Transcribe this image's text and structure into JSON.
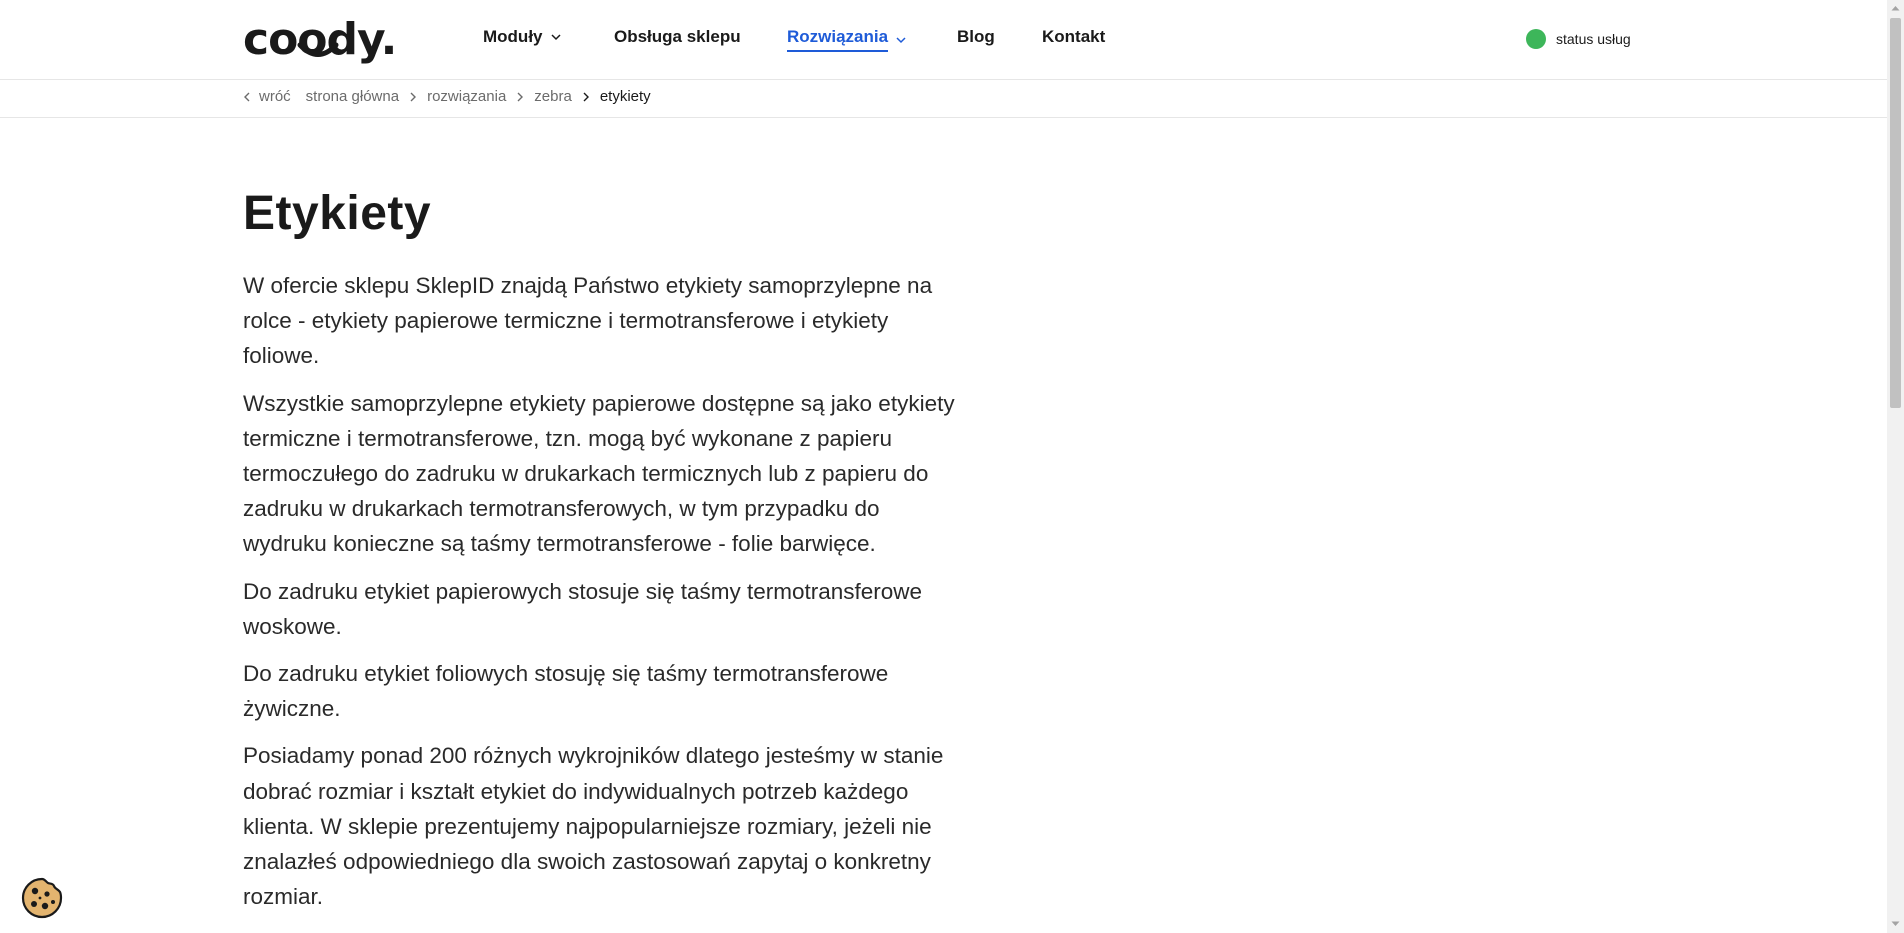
{
  "header": {
    "logo": "coody.",
    "nav": [
      {
        "label": "Moduły",
        "has_dropdown": true,
        "active": false
      },
      {
        "label": "Obsługa sklepu",
        "has_dropdown": false,
        "active": false
      },
      {
        "label": "Rozwiązania",
        "has_dropdown": true,
        "active": true
      },
      {
        "label": "Blog",
        "has_dropdown": false,
        "active": false
      },
      {
        "label": "Kontakt",
        "has_dropdown": false,
        "active": false
      }
    ],
    "status_label": "status usług",
    "status_color": "#3db65a",
    "accent_color": "#1e5bd8"
  },
  "breadcrumb": {
    "back_label": "wróć",
    "items": [
      "strona główna",
      "rozwiązania",
      "zebra"
    ],
    "current": "etykiety"
  },
  "main": {
    "title": "Etykiety",
    "paragraphs": [
      "W ofercie sklepu SklepID znajdą Państwo etykiety samoprzylepne na rolce - etykiety papierowe termiczne i termotransferowe i etykiety foliowe.",
      "Wszystkie samoprzylepne etykiety papierowe dostępne są jako etykiety termiczne i termotransferowe, tzn. mogą być wykonane z papieru termoczułego do zadruku w drukarkach termicznych lub z papieru do zadruku w drukarkach termotransferowych, w tym przypadku do wydruku konieczne są taśmy termotransferowe - folie barwięce.",
      "Do zadruku etykiet papierowych stosuje się taśmy termotransferowe woskowe.",
      "Do zadruku etykiet foliowych stosuję się taśmy termotransferowe żywiczne.",
      "Posiadamy ponad 200 różnych wykrojników dlatego jesteśmy w stanie dobrać rozmiar i kształt etykiet do indywidualnych potrzeb każdego klienta. W sklepie prezentujemy najpopularniejsze rozmiary, jeżeli nie znalazłeś odpowiedniego dla swoich zastosowań zapytaj o konkretny rozmiar."
    ]
  },
  "cookie_icon": "cookie-icon"
}
